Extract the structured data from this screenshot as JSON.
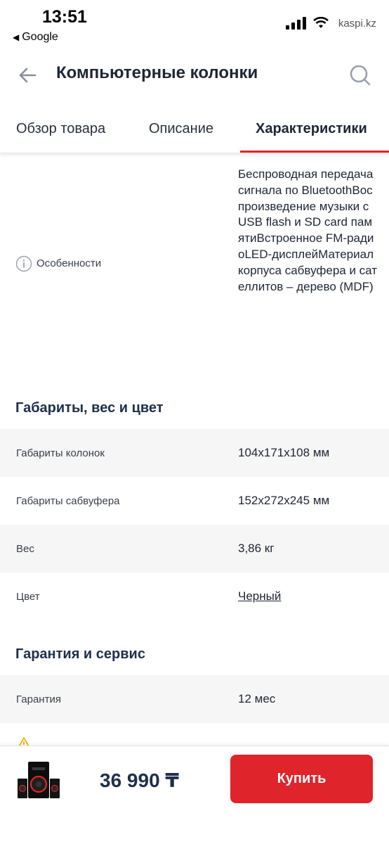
{
  "status_bar": {
    "time": "13:51",
    "back_app": "Google",
    "url": "kaspi.kz"
  },
  "header": {
    "title": "Компьютерные колонки",
    "back_icon": "arrow-left-icon",
    "search_icon": "search-icon"
  },
  "tabs": [
    {
      "label": "Обзор товара",
      "active": false
    },
    {
      "label": "Описание",
      "active": false
    },
    {
      "label": "Характеристики",
      "active": true
    }
  ],
  "features": {
    "label": "Особенности",
    "value": "Беспроводная передача сигнала по BluetoothВоспроизведение музыки с USB flash и SD card памятиВстроенное FM-радиоLED-дисплейМатериал корпуса сабвуфера и сателлитов – дерево (MDF)"
  },
  "sections": [
    {
      "title": "Габариты, вес и цвет",
      "rows": [
        {
          "label": "Габариты колонок",
          "value": "104x171x108 мм"
        },
        {
          "label": "Габариты сабвуфера",
          "value": "152x272x245 мм"
        },
        {
          "label": "Вес",
          "value": "3,86 кг"
        },
        {
          "label": "Цвет",
          "value": "Черный"
        }
      ]
    },
    {
      "title": "Гарантия и сервис",
      "rows": [
        {
          "label": "Гарантия",
          "value": "12 мес"
        }
      ]
    }
  ],
  "bottom_bar": {
    "price": "36 990 ₸",
    "buy_label": "Купить"
  },
  "colors": {
    "accent": "#e0242b",
    "title": "#1f2f4a",
    "shaded_row": "#f6f6f6"
  }
}
